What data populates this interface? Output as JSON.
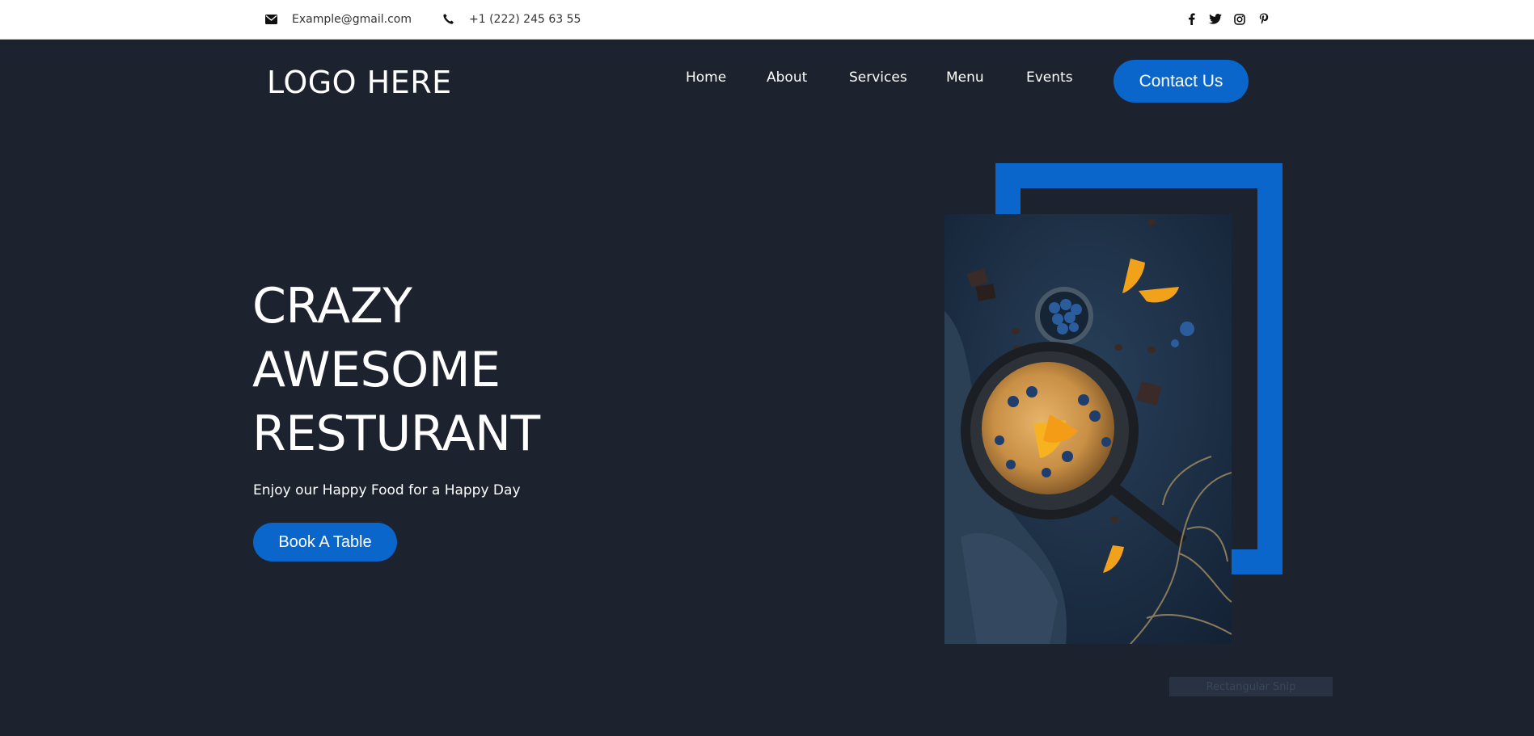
{
  "topbar": {
    "email": "Example@gmail.com",
    "phone": "+1 (222) 245 63 55",
    "social_icons": [
      "facebook-icon",
      "twitter-icon",
      "instagram-icon",
      "pinterest-icon"
    ]
  },
  "header": {
    "logo": "LOGO HERE",
    "nav": [
      "Home",
      "About",
      "Services",
      "Menu",
      "Events"
    ],
    "contact_label": "Contact Us"
  },
  "hero": {
    "title_lines": [
      "CRAZY",
      "AWESOME",
      "RESTURANT"
    ],
    "subtitle": "Enjoy our Happy Food for a Happy Day",
    "cta_label": "Book A Table"
  },
  "overlay": {
    "snip_label": "Rectangular Snip"
  },
  "colors": {
    "background": "#1c222e",
    "accent": "#0a66cb",
    "topbar": "#ffffff"
  }
}
